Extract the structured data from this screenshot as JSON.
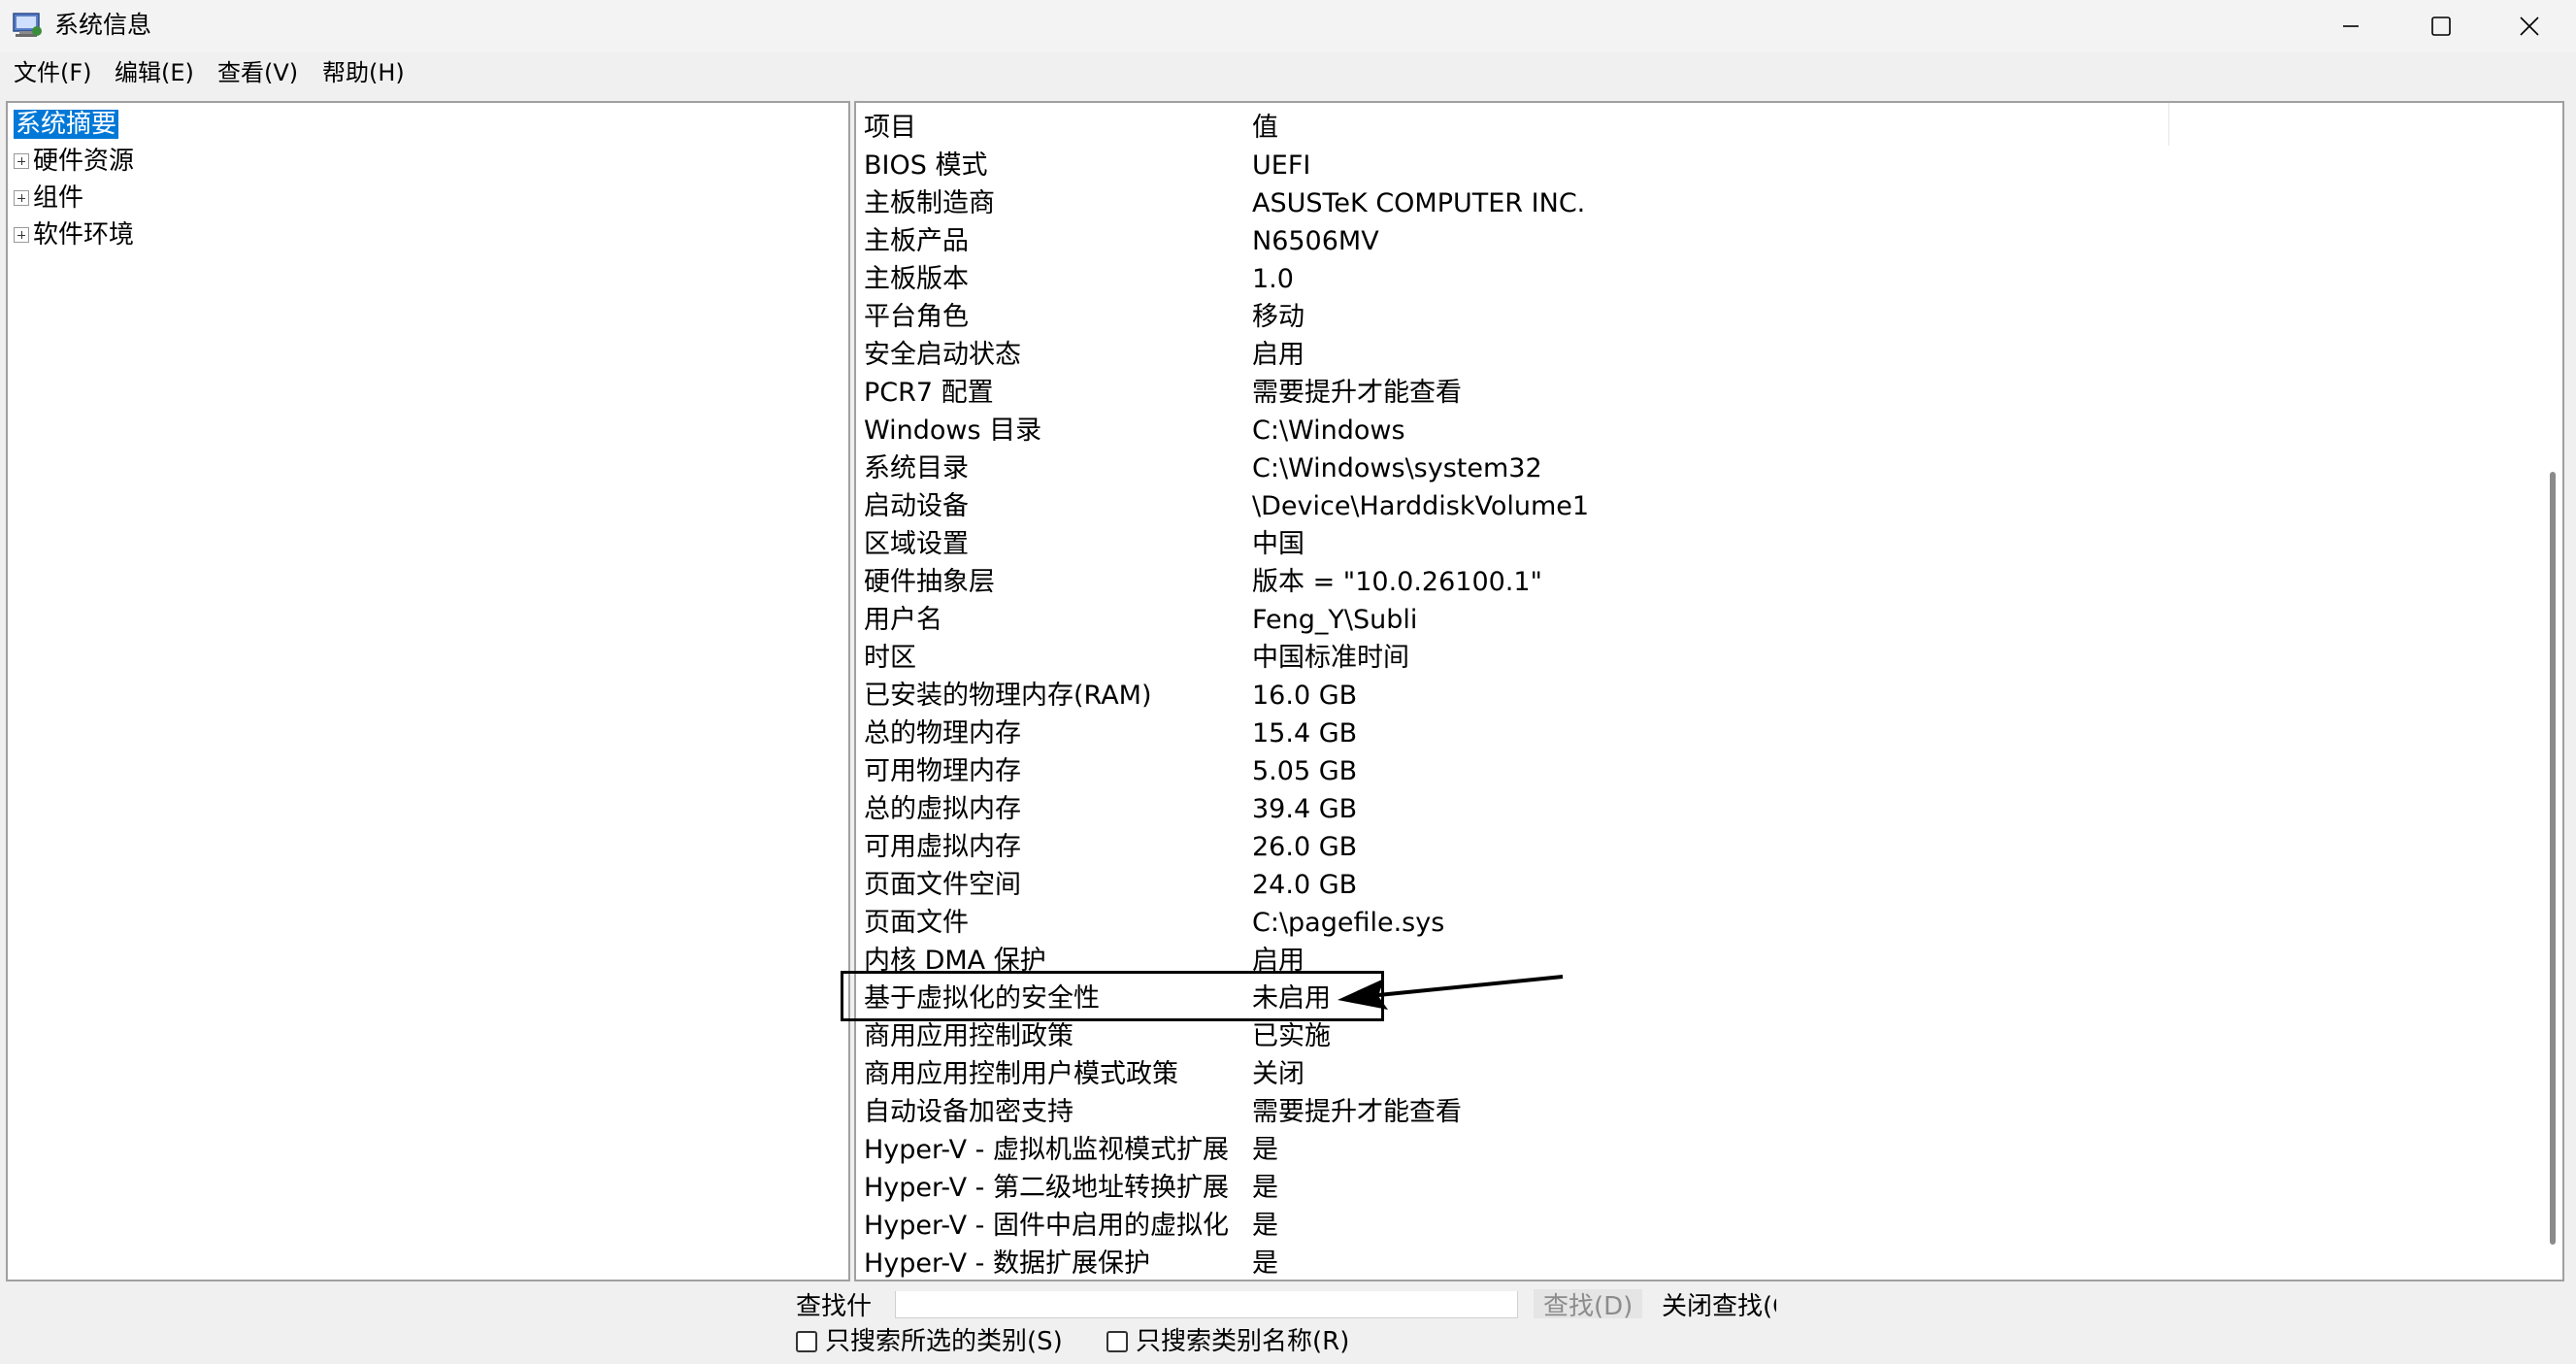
{
  "window": {
    "title": "系统信息",
    "icon": "system-info-icon"
  },
  "menu": [
    "文件(F)",
    "编辑(E)",
    "查看(V)",
    "帮助(H)"
  ],
  "tree": [
    {
      "label": "系统摘要",
      "selected": true,
      "expandable": false
    },
    {
      "label": "硬件资源",
      "selected": false,
      "expandable": true
    },
    {
      "label": "组件",
      "selected": false,
      "expandable": true
    },
    {
      "label": "软件环境",
      "selected": false,
      "expandable": true
    }
  ],
  "table": {
    "header": {
      "item": "项目",
      "value": "值"
    },
    "rows": [
      {
        "item": "BIOS 模式",
        "value": "UEFI"
      },
      {
        "item": "主板制造商",
        "value": "ASUSTeK COMPUTER INC."
      },
      {
        "item": "主板产品",
        "value": "N6506MV"
      },
      {
        "item": "主板版本",
        "value": "1.0"
      },
      {
        "item": "平台角色",
        "value": "移动"
      },
      {
        "item": "安全启动状态",
        "value": "启用"
      },
      {
        "item": "PCR7 配置",
        "value": "需要提升才能查看"
      },
      {
        "item": "Windows 目录",
        "value": "C:\\Windows"
      },
      {
        "item": "系统目录",
        "value": "C:\\Windows\\system32"
      },
      {
        "item": "启动设备",
        "value": "\\Device\\HarddiskVolume1"
      },
      {
        "item": "区域设置",
        "value": "中国"
      },
      {
        "item": "硬件抽象层",
        "value": "版本 = \"10.0.26100.1\""
      },
      {
        "item": "用户名",
        "value": "Feng_Y\\Subli"
      },
      {
        "item": "时区",
        "value": "中国标准时间"
      },
      {
        "item": "已安装的物理内存(RAM)",
        "value": "16.0 GB"
      },
      {
        "item": "总的物理内存",
        "value": "15.4 GB"
      },
      {
        "item": "可用物理内存",
        "value": "5.05 GB"
      },
      {
        "item": "总的虚拟内存",
        "value": "39.4 GB"
      },
      {
        "item": "可用虚拟内存",
        "value": "26.0 GB"
      },
      {
        "item": "页面文件空间",
        "value": "24.0 GB"
      },
      {
        "item": "页面文件",
        "value": "C:\\pagefile.sys"
      },
      {
        "item": "内核 DMA 保护",
        "value": "启用"
      },
      {
        "item": "基于虚拟化的安全性",
        "value": "未启用"
      },
      {
        "item": "商用应用控制政策",
        "value": "已实施"
      },
      {
        "item": "商用应用控制用户模式政策",
        "value": "关闭"
      },
      {
        "item": "自动设备加密支持",
        "value": "需要提升才能查看"
      },
      {
        "item": "Hyper-V - 虚拟机监视模式扩展",
        "value": "是"
      },
      {
        "item": "Hyper-V - 第二级地址转换扩展",
        "value": "是"
      },
      {
        "item": "Hyper-V - 固件中启用的虚拟化",
        "value": "是"
      },
      {
        "item": "Hyper-V - 数据扩展保护",
        "value": "是"
      }
    ]
  },
  "find": {
    "label": "查找什",
    "input_value": "",
    "find_button": "查找(D)",
    "close_find_button": "关闭查找(C",
    "search_selected_category": "只搜索所选的类别(S)",
    "search_category_names": "只搜索类别名称(R)"
  },
  "colors": {
    "selection": "#0078d7",
    "annotation": "#000000"
  }
}
